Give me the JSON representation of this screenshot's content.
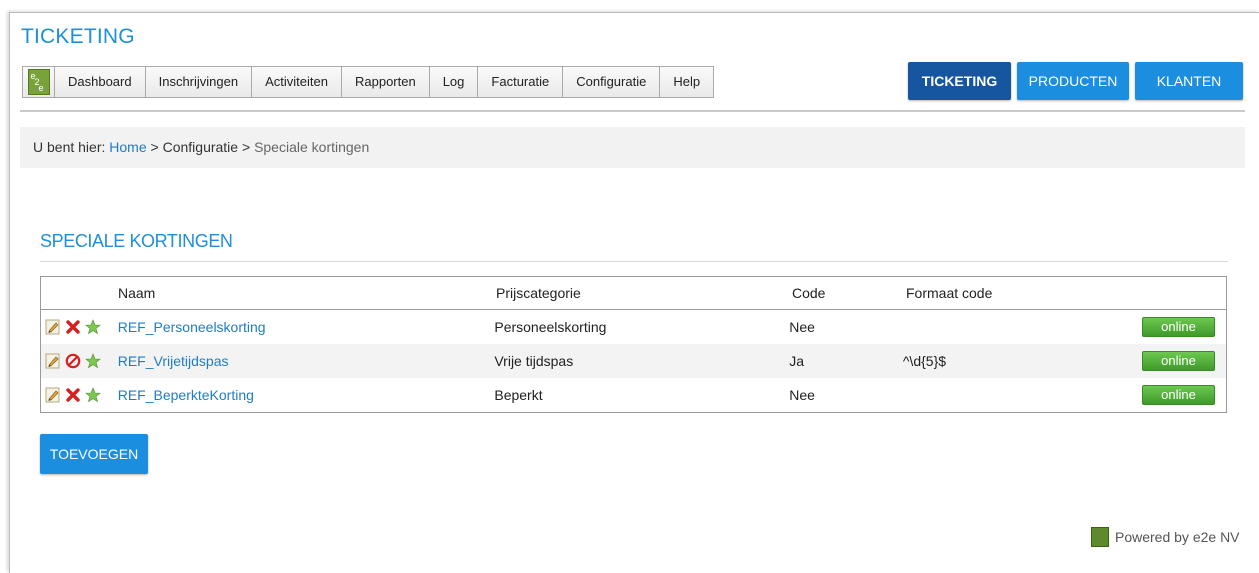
{
  "app": {
    "title": "TICKETING"
  },
  "nav": {
    "items": [
      "Dashboard",
      "Inschrijvingen",
      "Activiteiten",
      "Rapporten",
      "Log",
      "Facturatie",
      "Configuratie",
      "Help"
    ]
  },
  "modules": {
    "ticketing": "TICKETING",
    "producten": "PRODUCTEN",
    "klanten": "KLANTEN"
  },
  "breadcrumb": {
    "prefix": "U bent hier: ",
    "home": "Home",
    "sep1": " > ",
    "config": "Configuratie",
    "sep2": " > ",
    "current": "Speciale kortingen"
  },
  "page": {
    "title": "SPECIALE KORTINGEN"
  },
  "table": {
    "headers": {
      "name": "Naam",
      "price": "Prijscategorie",
      "code": "Code",
      "format": "Formaat code"
    },
    "rows": [
      {
        "name": "REF_Personeelskorting",
        "price": "Personeelskorting",
        "code": "Nee",
        "format": "",
        "status": "online",
        "delete_icon": "delete-icon"
      },
      {
        "name": "REF_Vrijetijdspas",
        "price": "Vrije tijdspas",
        "code": "Ja",
        "format": "^\\d{5}$",
        "status": "online",
        "delete_icon": "disabled-icon"
      },
      {
        "name": "REF_BeperkteKorting",
        "price": "Beperkt",
        "code": "Nee",
        "format": "",
        "status": "online",
        "delete_icon": "delete-icon"
      }
    ]
  },
  "actions": {
    "add_label": "TOEVOEGEN"
  },
  "footer": {
    "text": "Powered by e2e NV"
  },
  "colors": {
    "accent": "#1f8fd8",
    "active_tab": "#1656a0",
    "online": "#4fb23a",
    "delete": "#d42020"
  }
}
